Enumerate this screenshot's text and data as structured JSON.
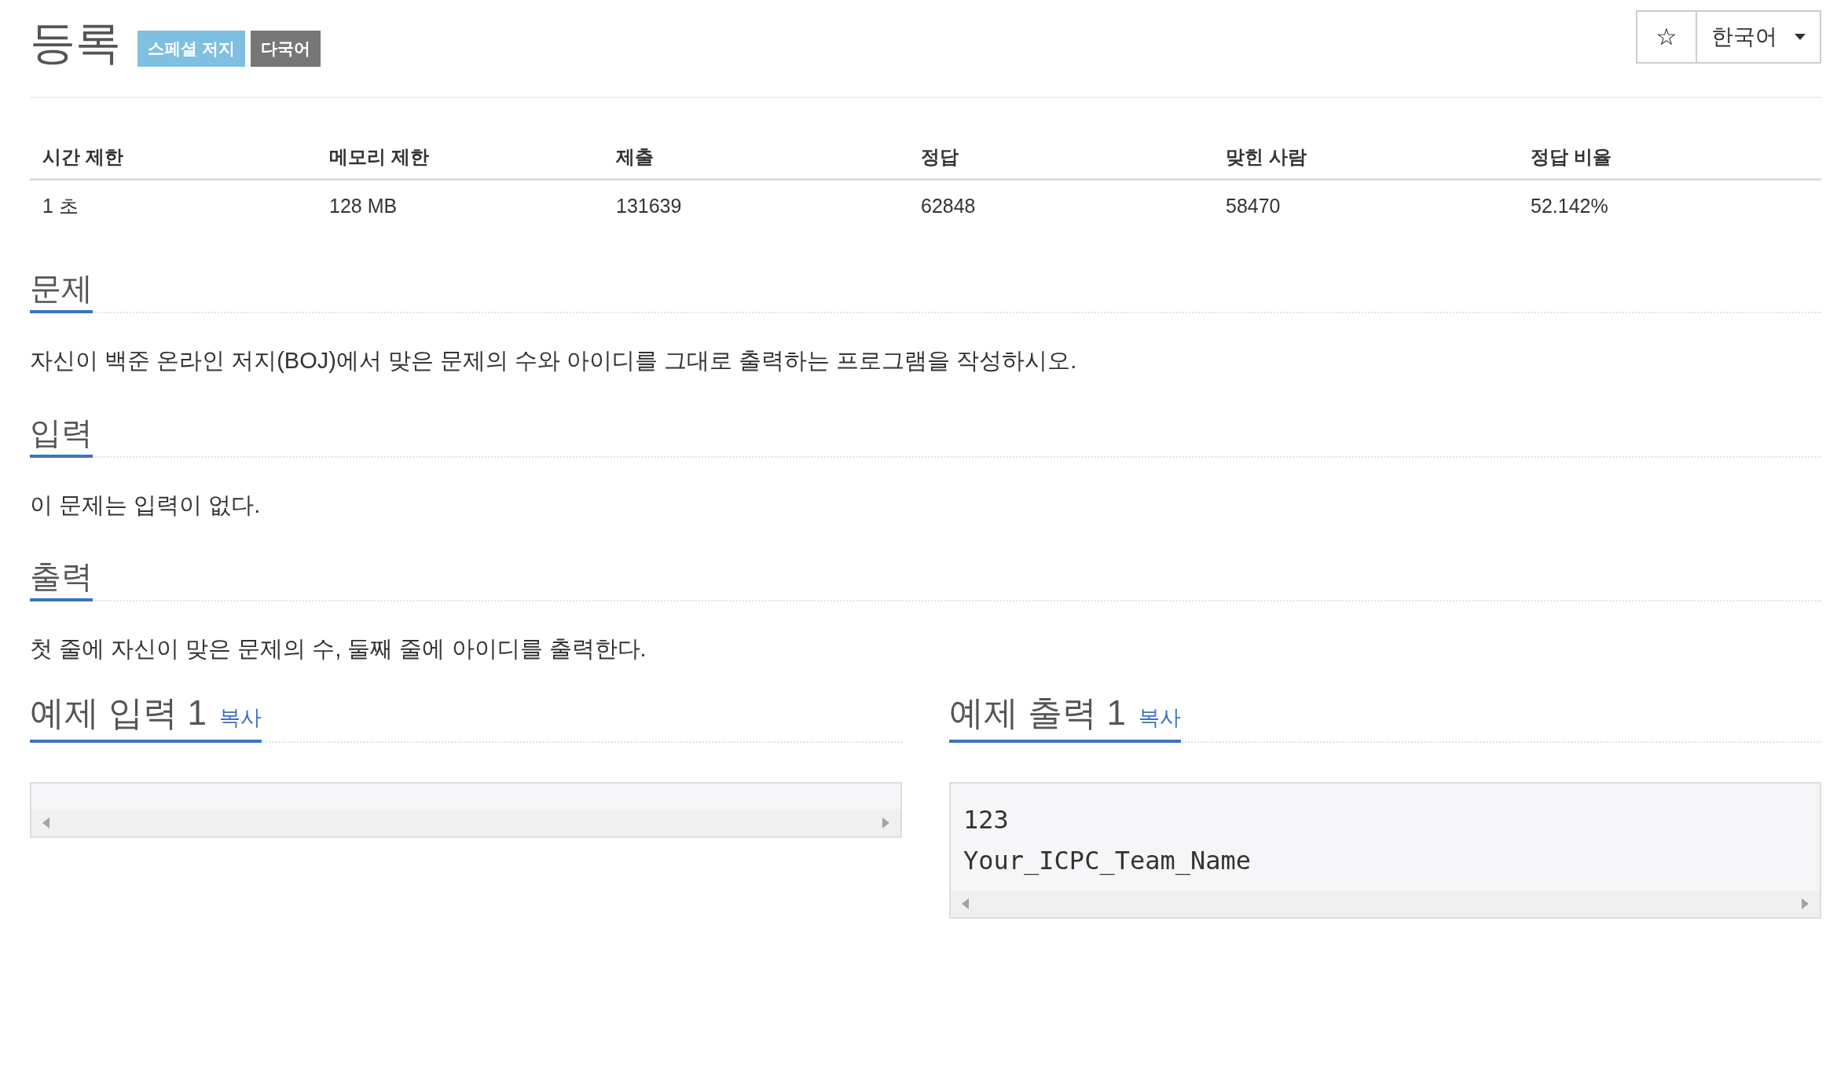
{
  "header": {
    "title": "등록",
    "badges": [
      {
        "label": "스페셜 저지",
        "color": "#7fbfdf"
      },
      {
        "label": "다국어",
        "color": "#777777"
      }
    ],
    "star_button": "☆",
    "language": "한국어"
  },
  "stats": {
    "columns": [
      "시간 제한",
      "메모리 제한",
      "제출",
      "정답",
      "맞힌 사람",
      "정답 비율"
    ],
    "row": [
      "1 초",
      "128 MB",
      "131639",
      "62848",
      "58470",
      "52.142%"
    ]
  },
  "sections": [
    {
      "heading": "문제",
      "text": "자신이 백준 온라인 저지(BOJ)에서 맞은 문제의 수와 아이디를 그대로 출력하는 프로그램을 작성하시오."
    },
    {
      "heading": "입력",
      "text": "이 문제는 입력이 없다."
    },
    {
      "heading": "출력",
      "text": "첫 줄에 자신이 맞은 문제의 수, 둘째 줄에 아이디를 출력한다."
    }
  ],
  "samples": [
    {
      "heading": "예제 입력 1",
      "copy": "복사"
    },
    {
      "heading": "예제 출력 1",
      "copy": "복사",
      "lines": [
        "123",
        "Your_ICPC_Team_Name"
      ]
    }
  ]
}
